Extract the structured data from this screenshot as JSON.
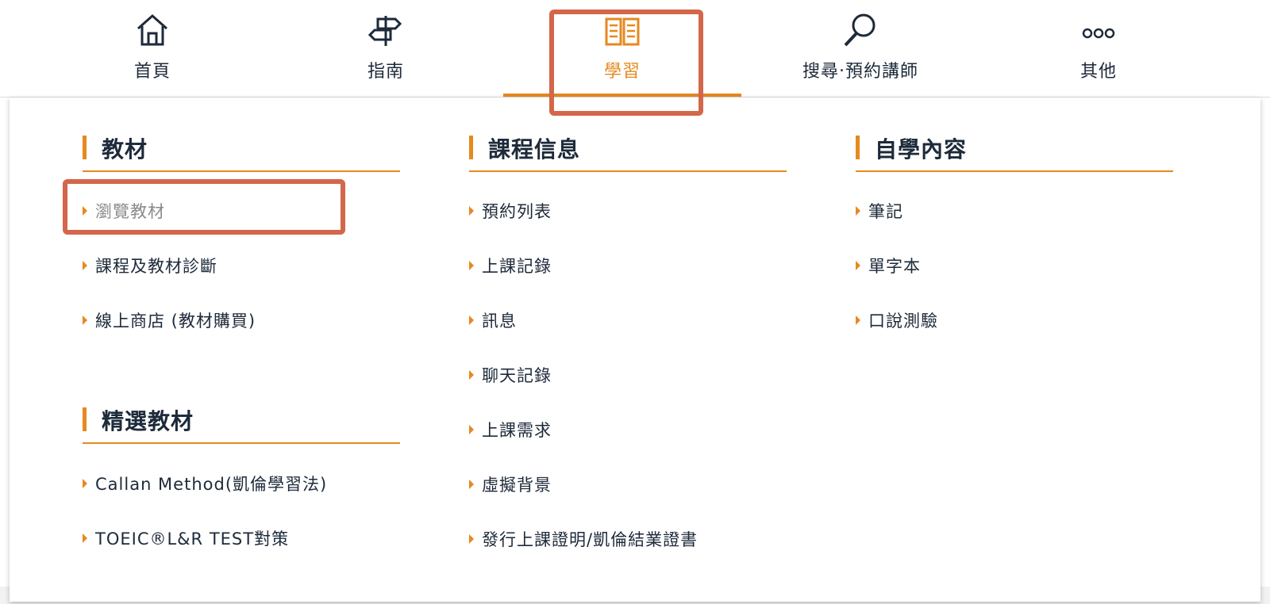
{
  "nav": {
    "items": [
      {
        "label": "首頁",
        "icon": "home-icon"
      },
      {
        "label": "指南",
        "icon": "signpost-icon"
      },
      {
        "label": "學習",
        "icon": "book-icon"
      },
      {
        "label": "搜尋‧預約講師",
        "icon": "search-icon"
      },
      {
        "label": "其他",
        "icon": "more-icon"
      }
    ],
    "active_index": 2
  },
  "colors": {
    "accent": "#e6891f",
    "annotation": "#d4664a",
    "text": "#1d2a3a"
  },
  "sections": {
    "materials": {
      "title": "教材",
      "links": [
        "瀏覽教材",
        "課程及教材診斷",
        "線上商店 (教材購買)"
      ]
    },
    "featured": {
      "title": "精選教材",
      "links": [
        "Callan Method(凱倫學習法)",
        "TOEIC®L&R TEST對策"
      ]
    },
    "course_info": {
      "title": "課程信息",
      "links": [
        "預約列表",
        "上課記錄",
        "訊息",
        "聊天記錄",
        "上課需求",
        "虛擬背景",
        "發行上課證明/凱倫結業證書"
      ]
    },
    "self_study": {
      "title": "自學內容",
      "links": [
        "筆記",
        "單字本",
        "口說測驗"
      ]
    }
  }
}
